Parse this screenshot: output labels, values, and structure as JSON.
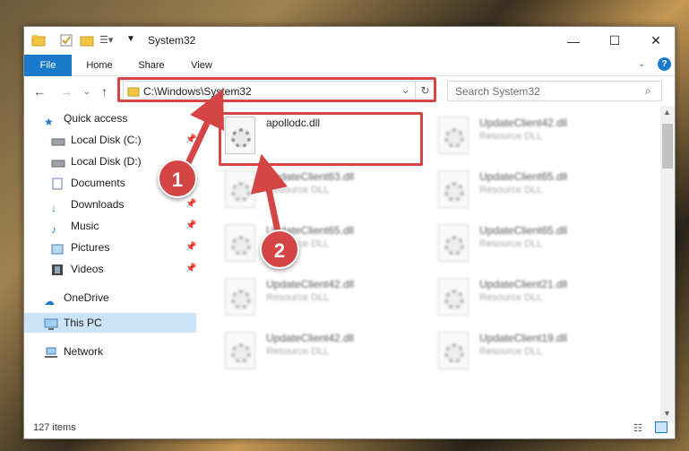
{
  "window": {
    "title": "System32"
  },
  "ribbon": {
    "tabs": [
      "File",
      "Home",
      "Share",
      "View"
    ]
  },
  "address": {
    "path": "C:\\Windows\\System32",
    "search_placeholder": "Search System32"
  },
  "nav": {
    "items": [
      {
        "label": "Quick access",
        "icon": "star-icon",
        "pinned": false
      },
      {
        "label": "Local Disk (C:)",
        "icon": "drive-icon",
        "pinned": true
      },
      {
        "label": "Local Disk (D:)",
        "icon": "drive-icon",
        "pinned": true
      },
      {
        "label": "Documents",
        "icon": "documents-icon",
        "pinned": true
      },
      {
        "label": "Downloads",
        "icon": "download-icon",
        "pinned": true
      },
      {
        "label": "Music",
        "icon": "music-icon",
        "pinned": true
      },
      {
        "label": "Pictures",
        "icon": "pictures-icon",
        "pinned": true
      },
      {
        "label": "Videos",
        "icon": "videos-icon",
        "pinned": true
      },
      {
        "label": "OneDrive",
        "icon": "cloud-icon",
        "pinned": false
      },
      {
        "label": "This PC",
        "icon": "computer-icon",
        "pinned": false
      },
      {
        "label": "Network",
        "icon": "network-icon",
        "pinned": false
      }
    ]
  },
  "files": [
    {
      "name": "apollodc.dll",
      "type": ""
    },
    {
      "name": "UpdateClient42.dll",
      "type": "Resource DLL"
    },
    {
      "name": "UpdateClient63.dll",
      "type": "Resource DLL"
    },
    {
      "name": "UpdateClient65.dll",
      "type": "Resource DLL"
    },
    {
      "name": "UpdateClient65.dll",
      "type": "Resource DLL"
    },
    {
      "name": "UpdateClient65.dll",
      "type": "Resource DLL"
    },
    {
      "name": "UpdateClient42.dll",
      "type": "Resource DLL"
    },
    {
      "name": "UpdateClient21.dll",
      "type": "Resource DLL"
    },
    {
      "name": "UpdateClient42.dll",
      "type": "Resource DLL"
    },
    {
      "name": "UpdateClient19.dll",
      "type": "Resource DLL"
    }
  ],
  "status": {
    "count": "127 items"
  },
  "annotations": {
    "step1": "1",
    "step2": "2"
  },
  "colors": {
    "accent": "#1979ca",
    "highlight": "#d64545"
  }
}
